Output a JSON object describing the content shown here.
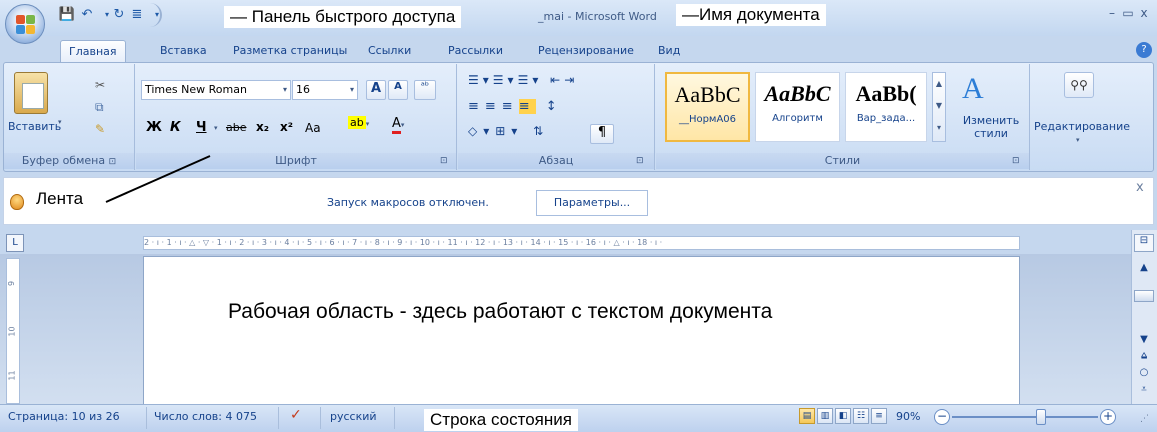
{
  "window": {
    "title": "_mai - Microsoft Word",
    "minimize": "–",
    "restore": "▭",
    "close": "x"
  },
  "annotations": {
    "qat": "— Панель быстрого доступа",
    "docname": "—Имя документа",
    "ribbon": "Лента",
    "workspace": "Рабочая область - здесь работают с текстом документа",
    "statusbar": "Строка состояния"
  },
  "tabs": [
    "Главная",
    "Вставка",
    "Разметка страницы",
    "Ссылки",
    "Рассылки",
    "Рецензирование",
    "Вид"
  ],
  "ribbon": {
    "clipboard": {
      "paste": "Вставить",
      "label": "Буфер обмена"
    },
    "font": {
      "name": "Times New Roman",
      "size": "16",
      "bold": "Ж",
      "italic": "К",
      "underline": "Ч",
      "strike": "abe",
      "sub": "x₂",
      "sup": "x²",
      "case": "Aa",
      "grow": "A",
      "shrink": "A",
      "label": "Шрифт"
    },
    "paragraph": {
      "label": "Абзац",
      "pilcrow": "¶"
    },
    "styles": {
      "items": [
        {
          "sample": "AaBbC",
          "name": "__НормА06"
        },
        {
          "sample": "AaBbC",
          "name": "Алгоритм"
        },
        {
          "sample": "AaBb(",
          "name": "Вар_зада..."
        }
      ],
      "change": "Изменить стили",
      "label": "Стили"
    },
    "editing": {
      "label": "Редактирование"
    }
  },
  "macro_bar": {
    "message": "Запуск макросов отключен.",
    "button": "Параметры...",
    "close": "x"
  },
  "ruler": {
    "labels": "2 · ı · 1 · ı · △ · ▽ · 1 · ı · 2 · ı · 3 · ı · 4 · ı · 5 · ı · 6 · ı · 7 · ı · 8 · ı · 9 · ı · 10 · ı · 11 · ı · 12 · ı · 13 · ı · 14 · ı · 15 · ı · 16 · ı · △ · ı · 18 · ı ·",
    "vlabels": [
      "9",
      "10",
      "11"
    ]
  },
  "status": {
    "page": "Страница: 10 из 26",
    "words": "Число слов: 4 075",
    "lang": "русский",
    "zoom": "90%",
    "zoom_minus": "−",
    "zoom_plus": "+"
  },
  "colors": {
    "accent": "#15428b",
    "ribbon_bg": "#d4e3f6"
  }
}
